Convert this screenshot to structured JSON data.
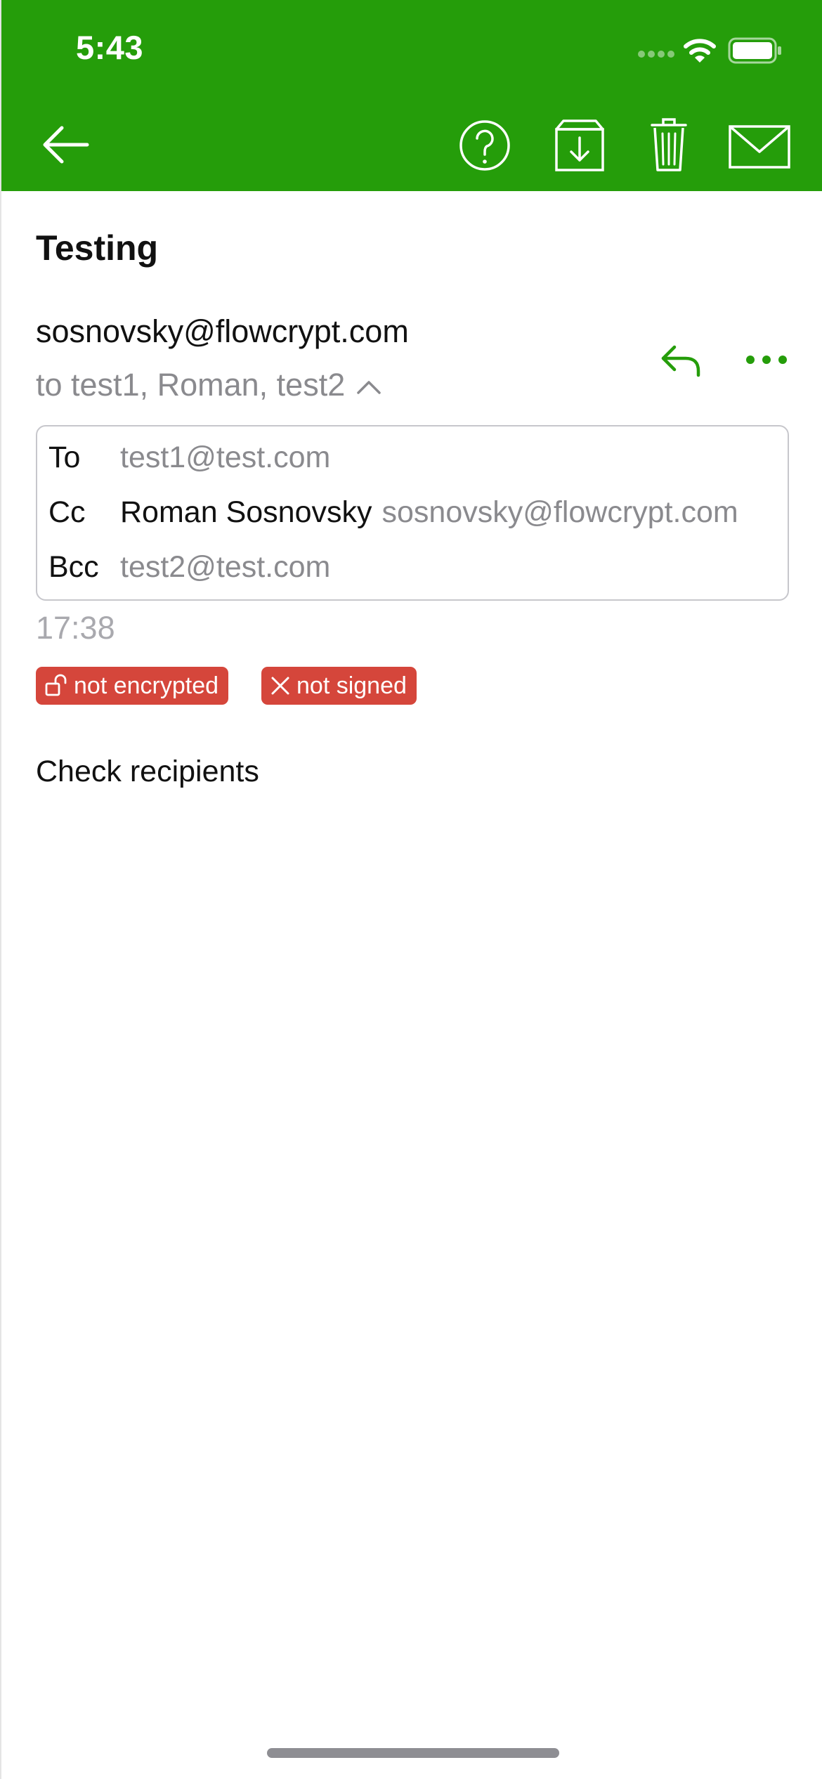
{
  "status_bar": {
    "time": "5:43",
    "icons": [
      "cellular-signal-icon",
      "wifi-icon",
      "battery-icon"
    ]
  },
  "toolbar": {
    "back_icon": "arrow-left-icon",
    "help_icon": "question-circle-icon",
    "archive_icon": "archive-download-icon",
    "trash_icon": "trash-icon",
    "mail_icon": "envelope-icon"
  },
  "message": {
    "subject": "Testing",
    "from": "sosnovsky@flowcrypt.com",
    "recipients_summary": "to test1, Roman, test2",
    "time": "17:38",
    "body": "Check recipients"
  },
  "recipients": {
    "to": {
      "label": "To",
      "email": "test1@test.com"
    },
    "cc": {
      "label": "Cc",
      "name": "Roman Sosnovsky",
      "email": "sosnovsky@flowcrypt.com"
    },
    "bcc": {
      "label": "Bcc",
      "email": "test2@test.com"
    }
  },
  "badges": {
    "encryption": {
      "label": "not encrypted",
      "icon": "unlocked-padlock-icon"
    },
    "signature": {
      "label": "not signed",
      "icon": "x-mark-icon"
    }
  },
  "colors": {
    "brand_green": "#259d0a",
    "badge_red": "#d5463b",
    "secondary_text": "#8a8a8e"
  }
}
